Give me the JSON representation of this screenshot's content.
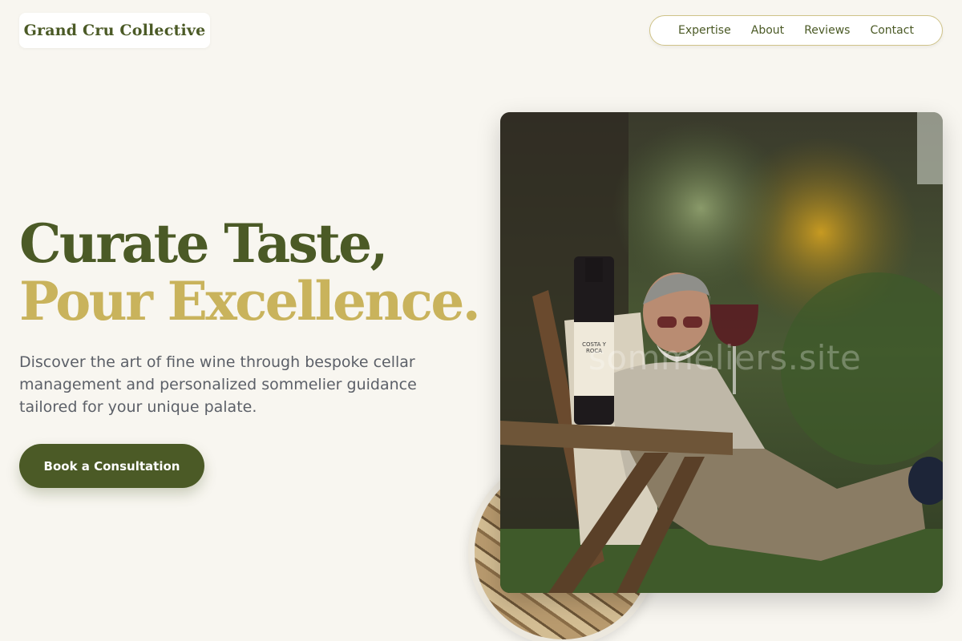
{
  "brand": {
    "name": "Grand Cru Collective"
  },
  "nav": {
    "items": [
      {
        "label": "Expertise"
      },
      {
        "label": "About"
      },
      {
        "label": "Reviews"
      },
      {
        "label": "Contact"
      }
    ]
  },
  "hero": {
    "headline_line1": "Curate Taste,",
    "headline_line2": "Pour Excellence.",
    "description": "Discover the art of fine wine through bespoke cellar management and personalized sommelier guidance tailored for your unique palate.",
    "cta_label": "Book a Consultation",
    "image_watermark": "sommeliers.site",
    "bottle_label": "COSTA Y ROCA"
  },
  "colors": {
    "background": "#f8f6f0",
    "primary_olive": "#4b5a26",
    "accent_gold": "#c9b35c",
    "body_text": "#5c6068"
  }
}
